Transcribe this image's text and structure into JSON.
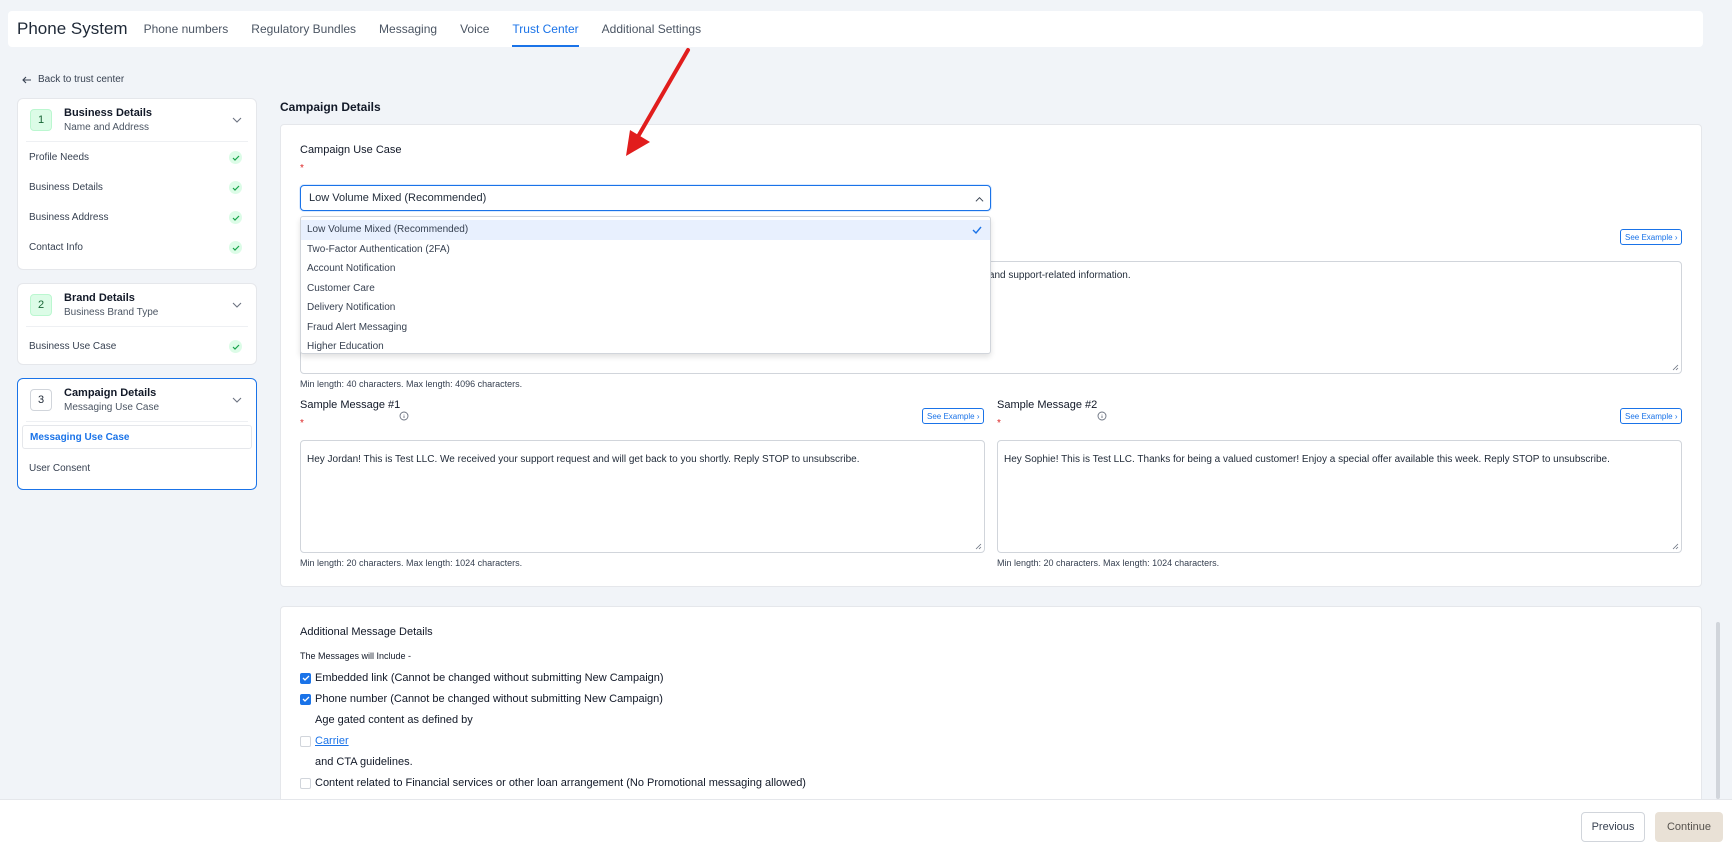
{
  "app": {
    "title": "Phone System"
  },
  "nav": {
    "tabs": [
      {
        "label": "Phone numbers"
      },
      {
        "label": "Regulatory Bundles"
      },
      {
        "label": "Messaging"
      },
      {
        "label": "Voice"
      },
      {
        "label": "Trust Center",
        "active": true
      },
      {
        "label": "Additional Settings"
      }
    ]
  },
  "back_link": "Back to trust center",
  "steps": [
    {
      "number": "1",
      "title": "Business Details",
      "subtitle": "Name and Address",
      "items": [
        "Profile Needs",
        "Business Details",
        "Business Address",
        "Contact Info"
      ]
    },
    {
      "number": "2",
      "title": "Brand Details",
      "subtitle": "Business Brand Type",
      "items": [
        "Business Use Case"
      ]
    },
    {
      "number": "3",
      "title": "Campaign Details",
      "subtitle": "Messaging Use Case",
      "items": [
        "Messaging Use Case",
        "User Consent"
      ]
    }
  ],
  "main": {
    "section_title": "Campaign Details",
    "use_case_label": "Campaign Use Case",
    "required_mark": "*",
    "selected_use_case": "Low Volume Mixed (Recommended)",
    "use_case_options": [
      "Low Volume Mixed (Recommended)",
      "Two-Factor Authentication (2FA)",
      "Account Notification",
      "Customer Care",
      "Delivery Notification",
      "Fraud Alert Messaging",
      "Higher Education"
    ],
    "see_example": "See Example",
    "description_visible_text": "tions and support-related information.",
    "description_hint": "Min length: 40 characters. Max length: 4096 characters.",
    "sample1_label": "Sample Message #1",
    "sample1_value": "Hey Jordan! This is Test LLC. We received your support request and will get back to you shortly. Reply STOP to unsubscribe.",
    "sample1_hint": "Min length: 20 characters. Max length: 1024 characters.",
    "sample2_label": "Sample Message #2",
    "sample2_value": "Hey Sophie! This is Test LLC. Thanks for being a valued customer! Enjoy a special offer available this week. Reply STOP to unsubscribe.",
    "sample2_hint": "Min length: 20 characters. Max length: 1024 characters."
  },
  "additional": {
    "title": "Additional Message Details",
    "intro": "The Messages will Include -",
    "embedded_link": "Embedded link (Cannot be changed without submitting New Campaign)",
    "phone_number": "Phone number (Cannot be changed without submitting New Campaign)",
    "age_gated": "Age gated content as defined by",
    "carrier_link": "Carrier",
    "cta": "and CTA guidelines.",
    "financial": "Content related to Financial services or other loan arrangement (No Promotional messaging allowed)"
  },
  "footer": {
    "previous": "Previous",
    "continue": "Continue"
  },
  "colors": {
    "accent": "#1a73e8",
    "success": "#16a34a",
    "annotation_arrow": "#e11d1d"
  }
}
